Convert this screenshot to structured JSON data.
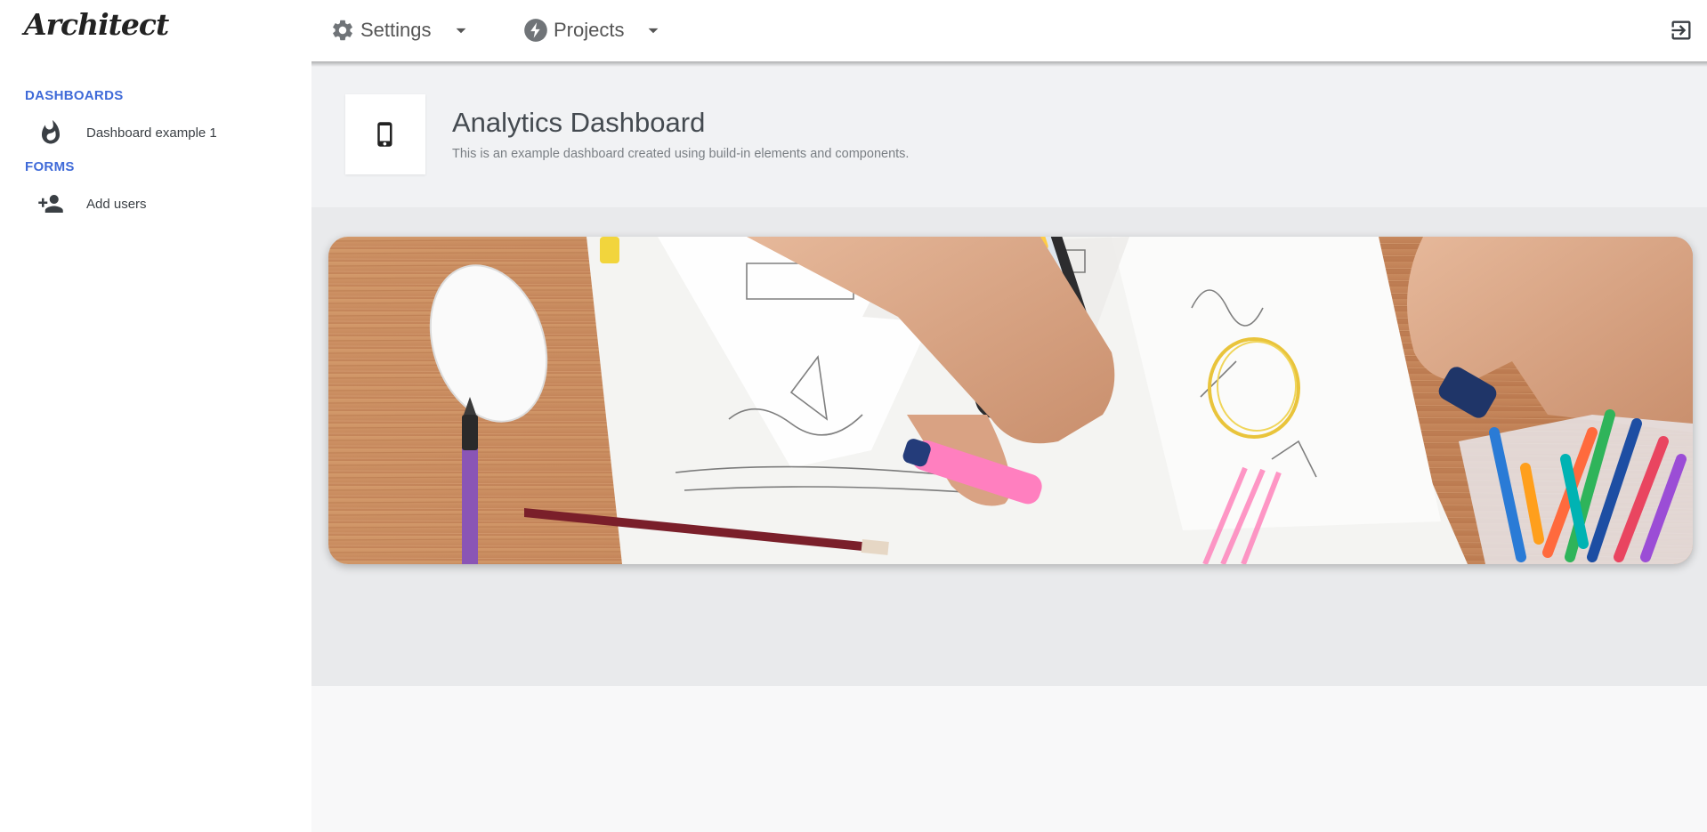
{
  "app": {
    "logo": "Architect"
  },
  "header": {
    "menus": [
      {
        "label": "Settings",
        "icon": "gear-icon"
      },
      {
        "label": "Projects",
        "icon": "bolt-icon"
      }
    ],
    "logout_icon": "logout-icon"
  },
  "sidebar": {
    "sections": [
      {
        "title": "DASHBOARDS",
        "items": [
          {
            "label": "Dashboard example 1",
            "icon": "fire-icon"
          }
        ]
      },
      {
        "title": "FORMS",
        "items": [
          {
            "label": "Add users",
            "icon": "person-add-icon"
          }
        ]
      }
    ]
  },
  "page": {
    "title": "Analytics Dashboard",
    "subtitle": "This is an example dashboard created using build-in elements and components.",
    "title_icon": "smartphone-icon"
  },
  "banner": {
    "image": "desk-workspace-photo"
  },
  "colors": {
    "accent": "#3f6ad8",
    "wood": "#c8875a"
  }
}
